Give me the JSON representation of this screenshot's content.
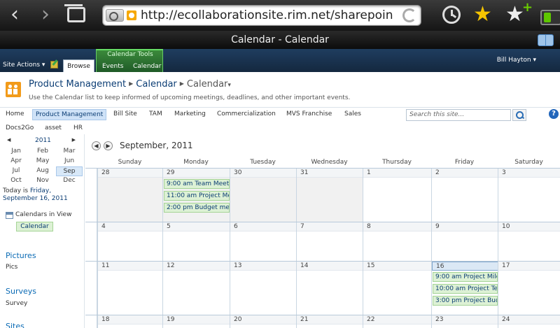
{
  "browser": {
    "url": "http://ecollaborationsite.rim.net/sharepointsite/PdM/C",
    "page_title": "Calendar - Calendar"
  },
  "ribbon": {
    "site_actions": "Site Actions ▾",
    "browse_tab": "Browse",
    "tools_group": "Calendar Tools",
    "events_tab": "Events",
    "calendar_tab": "Calendar",
    "user": "Bill Hayton ▾"
  },
  "header": {
    "crumb_site": "Product Management",
    "crumb_list": "Calendar",
    "crumb_view": "Calendar",
    "crumb_view_arrow": "▾",
    "description": "Use the Calendar list to keep informed of upcoming meetings, deadlines, and other important events."
  },
  "topnav": {
    "items": [
      "Home",
      "Product Management",
      "Bill Site",
      "TAM",
      "Marketing",
      "Commercialization",
      "MVS Franchise",
      "Sales"
    ],
    "items2": [
      "Docs2Go",
      "asset",
      "HR"
    ],
    "search_placeholder": "Search this site...",
    "help": "?"
  },
  "mini_calendar": {
    "prev": "◀",
    "next": "▶",
    "year": "2011",
    "months": [
      "Jan",
      "Feb",
      "Mar",
      "Apr",
      "May",
      "Jun",
      "Jul",
      "Aug",
      "Sep",
      "Oct",
      "Nov",
      "Dec"
    ],
    "selected": "Sep",
    "today_prefix": "Today is ",
    "today_date": "Friday, September 16, 2011"
  },
  "calendars_in_view": {
    "label": "Calendars in View",
    "chip": "Calendar"
  },
  "quick_launch": {
    "pictures": "Pictures",
    "pics": "Pics",
    "surveys": "Surveys",
    "survey": "Survey",
    "sites": "Sites"
  },
  "calendar": {
    "prev": "◀",
    "next": "▶",
    "month": "September, 2011",
    "days_of_week": [
      "Sunday",
      "Monday",
      "Tuesday",
      "Wednesday",
      "Thursday",
      "Friday",
      "Saturday"
    ],
    "weeks": [
      {
        "days": [
          {
            "num": "28",
            "other": true,
            "events": []
          },
          {
            "num": "29",
            "other": true,
            "events": [
              "9:00 am Team Meet",
              "11:00 am Project Me",
              "2:00 pm Budget mee"
            ]
          },
          {
            "num": "30",
            "other": true,
            "events": []
          },
          {
            "num": "31",
            "other": true,
            "events": []
          },
          {
            "num": "1",
            "other": false,
            "events": []
          },
          {
            "num": "2",
            "other": false,
            "events": []
          },
          {
            "num": "3",
            "other": false,
            "events": []
          }
        ]
      },
      {
        "days": [
          {
            "num": "4",
            "other": false,
            "events": []
          },
          {
            "num": "5",
            "other": false,
            "events": []
          },
          {
            "num": "6",
            "other": false,
            "events": []
          },
          {
            "num": "7",
            "other": false,
            "events": []
          },
          {
            "num": "8",
            "other": false,
            "events": []
          },
          {
            "num": "9",
            "other": false,
            "events": []
          },
          {
            "num": "10",
            "other": false,
            "events": []
          }
        ]
      },
      {
        "days": [
          {
            "num": "11",
            "other": false,
            "events": []
          },
          {
            "num": "12",
            "other": false,
            "events": []
          },
          {
            "num": "13",
            "other": false,
            "events": []
          },
          {
            "num": "14",
            "other": false,
            "events": []
          },
          {
            "num": "15",
            "other": false,
            "events": []
          },
          {
            "num": "16",
            "other": false,
            "today": true,
            "events": [
              "9:00 am Project Mile",
              "10:00 am Project Te",
              "3:00 pm Project Bud"
            ]
          },
          {
            "num": "17",
            "other": false,
            "events": []
          }
        ]
      },
      {
        "days": [
          {
            "num": "18",
            "other": false,
            "events": []
          },
          {
            "num": "19",
            "other": false,
            "events": []
          },
          {
            "num": "20",
            "other": false,
            "events": []
          },
          {
            "num": "21",
            "other": false,
            "events": []
          },
          {
            "num": "22",
            "other": false,
            "events": []
          },
          {
            "num": "23",
            "other": false,
            "events": []
          },
          {
            "num": "24",
            "other": false,
            "events": []
          }
        ]
      }
    ]
  }
}
